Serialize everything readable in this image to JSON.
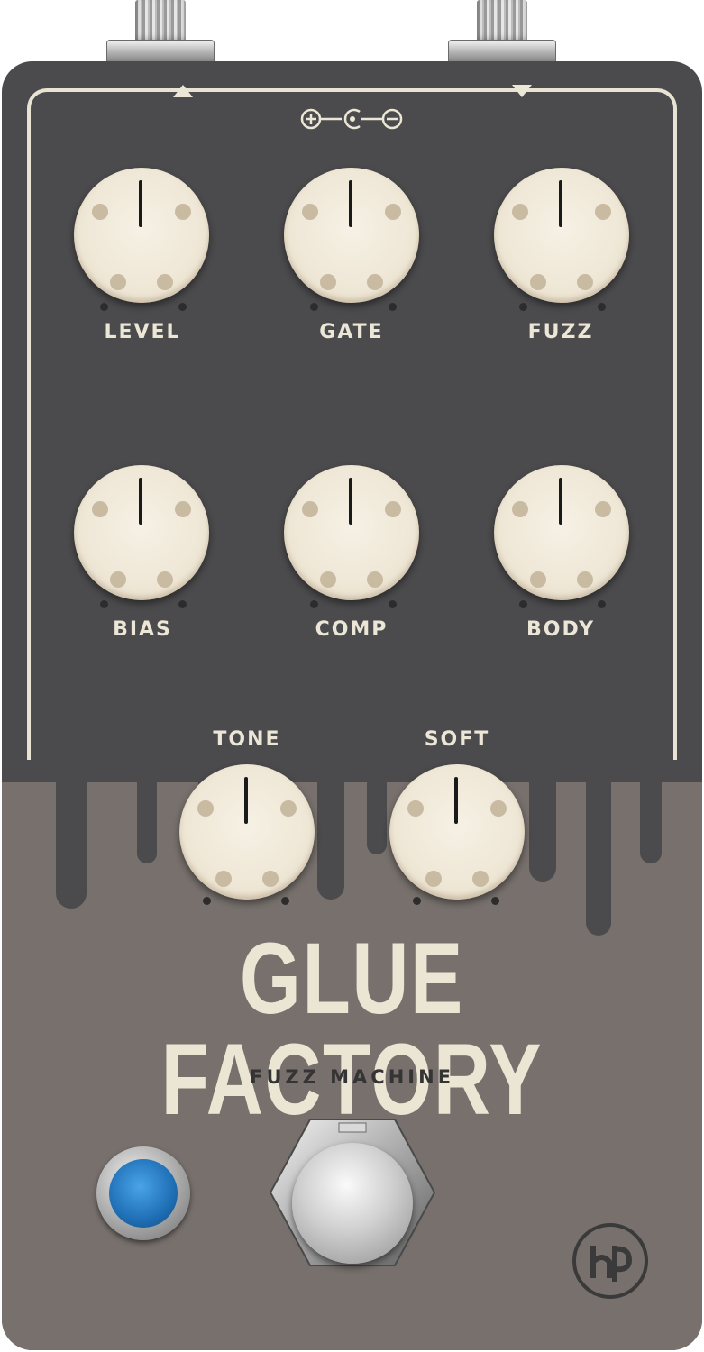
{
  "pedal": {
    "title": "GLUE FACTORY",
    "subtitle": "FUZZ MACHINE",
    "colors": {
      "upper_panel": "#4b4b4d",
      "lower_panel": "#77706c",
      "cream": "#ece6d6",
      "led_blue": "#1f6fb5"
    }
  },
  "knobs": [
    {
      "label": "LEVEL"
    },
    {
      "label": "GATE"
    },
    {
      "label": "FUZZ"
    },
    {
      "label": "BIAS"
    },
    {
      "label": "COMP"
    },
    {
      "label": "BODY"
    },
    {
      "label": "TONE"
    },
    {
      "label": "SOFT"
    }
  ],
  "icons": {
    "power": "dc-power-polarity-icon",
    "input": "input-arrow-icon",
    "output": "output-arrow-icon",
    "logo": "brand-logo-icon"
  }
}
